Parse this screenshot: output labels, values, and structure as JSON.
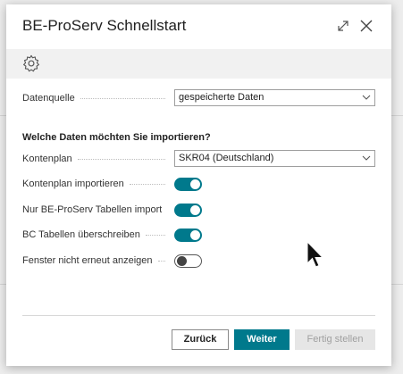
{
  "dialog": {
    "title": "BE-ProServ Schnellstart",
    "expand_icon": "expand-icon",
    "close_icon": "close-icon"
  },
  "actionbar": {
    "settings_icon": "gear-icon"
  },
  "fields": {
    "datenquelle": {
      "label": "Datenquelle",
      "value": "gespeicherte Daten"
    },
    "section_title": "Welche Daten möchten Sie importieren?",
    "kontenplan": {
      "label": "Kontenplan",
      "value": "SKR04 (Deutschland)"
    },
    "kontenplan_import": {
      "label": "Kontenplan importieren",
      "on": true
    },
    "nur_tabellen": {
      "label": "Nur BE-ProServ Tabellen import...",
      "on": true
    },
    "bc_tabellen": {
      "label": "BC Tabellen überschreiben",
      "on": true
    },
    "fenster": {
      "label": "Fenster nicht erneut anzeigen",
      "on": false
    }
  },
  "footer": {
    "back_label": "Zurück",
    "next_label": "Weiter",
    "finish_label": "Fertig stellen"
  },
  "colors": {
    "accent": "#00798c",
    "disabled_bg": "#e6e6e6"
  }
}
